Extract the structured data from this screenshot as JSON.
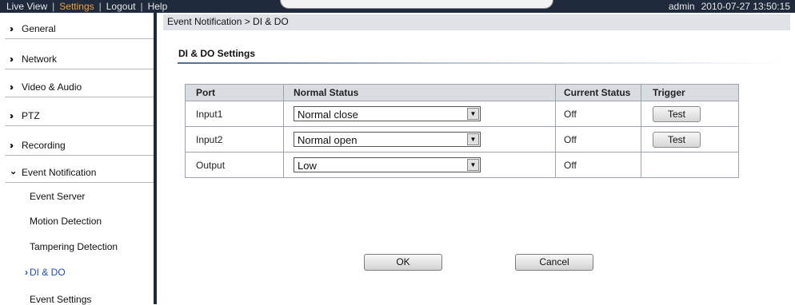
{
  "topbar": {
    "nav": [
      "Live View",
      "Settings",
      "Logout",
      "Help"
    ],
    "active_nav": "Settings",
    "separator": "|",
    "user": "admin",
    "datetime": "2010-07-27 13:50:15"
  },
  "sidebar": {
    "sections": [
      {
        "label": "General"
      },
      {
        "label": "Network"
      },
      {
        "label": "Video & Audio"
      },
      {
        "label": "PTZ"
      },
      {
        "label": "Recording"
      },
      {
        "label": "Event Notification",
        "expanded": true
      }
    ],
    "subitems": [
      {
        "label": "Event Server"
      },
      {
        "label": "Motion Detection"
      },
      {
        "label": "Tampering Detection"
      },
      {
        "label": "DI & DO",
        "active": true
      },
      {
        "label": "Event Settings"
      }
    ]
  },
  "breadcrumb": "Event Notification > DI & DO",
  "section_title": "DI & DO Settings",
  "table": {
    "headers": [
      "Port",
      "Normal Status",
      "Current Status",
      "Trigger"
    ],
    "rows": [
      {
        "port": "Input1",
        "normal_status": "Normal close",
        "current_status": "Off",
        "trigger": "Test"
      },
      {
        "port": "Input2",
        "normal_status": "Normal open",
        "current_status": "Off",
        "trigger": "Test"
      },
      {
        "port": "Output",
        "normal_status": "Low",
        "current_status": "Off",
        "trigger": ""
      }
    ]
  },
  "buttons": {
    "ok": "OK",
    "cancel": "Cancel"
  },
  "icons": {
    "section_collapsed": "double-chevron-right-icon",
    "section_expanded": "double-chevron-down-icon",
    "active_sub": "chevron-right-icon",
    "dropdown": "dropdown-arrow-icon"
  },
  "colors": {
    "topbar_bg": "#1f2a3c",
    "active_nav": "#f0a23a",
    "active_link": "#1a4fb0"
  }
}
